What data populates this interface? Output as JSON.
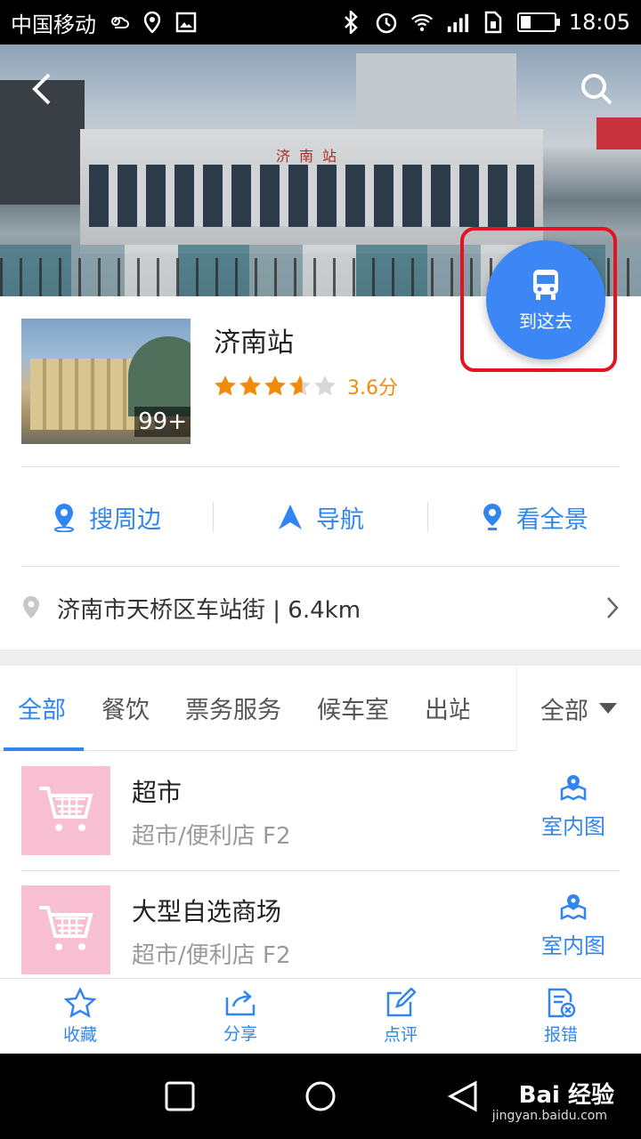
{
  "status_bar": {
    "carrier": "中国移动",
    "time": "18:05",
    "battery_level": 0.3
  },
  "hero": {
    "sign_text": "济南站"
  },
  "fab": {
    "label": "到这去",
    "icon": "bus-icon",
    "color": "#3d86f5"
  },
  "poi": {
    "name": "济南站",
    "photo_count": "99+",
    "rating_value": 3.6,
    "score_text": "3.6分"
  },
  "actions": [
    {
      "label": "搜周边",
      "icon": "location-pin-icon"
    },
    {
      "label": "导航",
      "icon": "navigation-arrow-icon"
    },
    {
      "label": "看全景",
      "icon": "panorama-pin-icon"
    }
  ],
  "address": {
    "text": "济南市天桥区车站街 | 6.4km"
  },
  "tabs": {
    "items": [
      "全部",
      "餐饮",
      "票务服务",
      "候车室",
      "出站口"
    ],
    "active_index": 0,
    "filter_label": "全部"
  },
  "list": [
    {
      "title": "超市",
      "subtitle": "超市/便利店 F2",
      "action_label": "室内图"
    },
    {
      "title": "大型自选商场",
      "subtitle": "超市/便利店 F2",
      "action_label": "室内图"
    }
  ],
  "bottom_bar": [
    {
      "label": "收藏",
      "icon": "star-outline-icon"
    },
    {
      "label": "分享",
      "icon": "share-icon"
    },
    {
      "label": "点评",
      "icon": "edit-icon"
    },
    {
      "label": "报错",
      "icon": "report-error-icon"
    }
  ],
  "watermark": {
    "brand": "Bai 经验",
    "url": "jingyan.baidu.com"
  },
  "colors": {
    "accent": "#3185f0",
    "score": "#f28b0c",
    "highlight_border": "#e3141f",
    "list_icon_bg": "#f7bfd1"
  }
}
